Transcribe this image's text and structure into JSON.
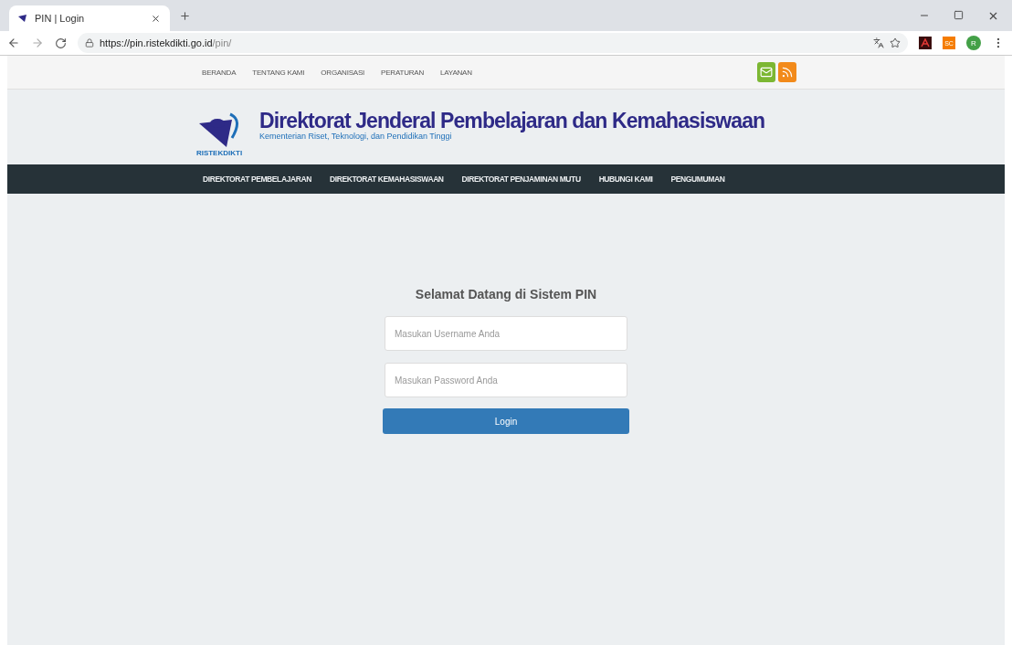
{
  "browser": {
    "tab_title": "PIN | Login",
    "url_host": "https://pin.ristekdikti.go.id",
    "url_path": "/pin/",
    "extension_label": "SC",
    "profile_initial": "R"
  },
  "top_nav": [
    "BERANDA",
    "TENTANG KAMI",
    "ORGANISASI",
    "PERATURAN",
    "LAYANAN"
  ],
  "header": {
    "logo_text": "RISTEKDIKTI",
    "title": "Direktorat Jenderal Pembelajaran dan Kemahasiswaan",
    "subtitle": "Kementerian Riset, Teknologi, dan Pendidikan Tinggi"
  },
  "main_nav": [
    "DIREKTORAT PEMBELAJARAN",
    "DIREKTORAT KEMAHASISWAAN",
    "DIREKTORAT PENJAMINAN MUTU",
    "HUBUNGI KAMI",
    "PENGUMUMAN"
  ],
  "login": {
    "heading": "Selamat Datang di Sistem PIN",
    "fields": [
      {
        "placeholder": "Masukan Username Anda"
      },
      {
        "placeholder": "Masukan Password Anda"
      }
    ],
    "button": "Login"
  }
}
